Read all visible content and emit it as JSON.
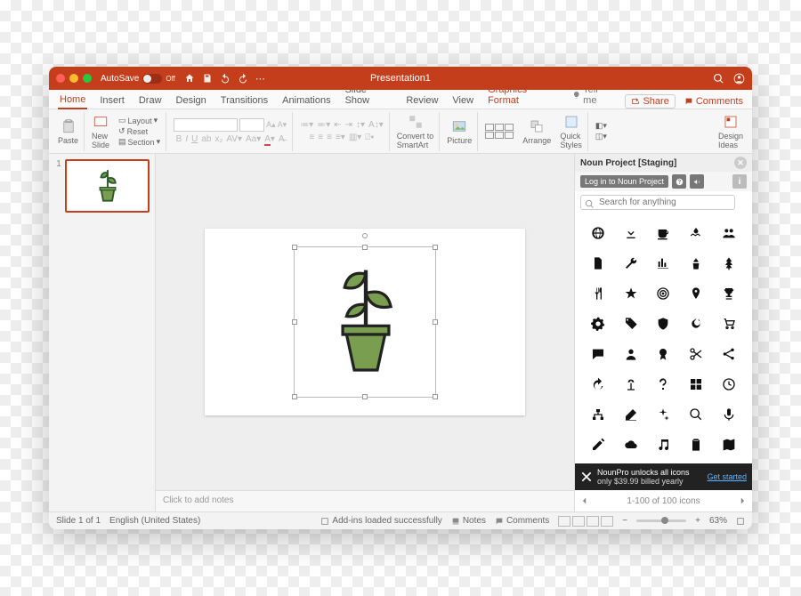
{
  "window": {
    "title": "Presentation1",
    "autosave_label": "AutoSave",
    "autosave_state": "Off"
  },
  "tabs": {
    "items": [
      "Home",
      "Insert",
      "Draw",
      "Design",
      "Transitions",
      "Animations",
      "Slide Show",
      "Review",
      "View"
    ],
    "context": "Graphics Format",
    "tellme": "Tell me",
    "share": "Share",
    "comments": "Comments",
    "active_index": 0
  },
  "ribbon": {
    "paste": "Paste",
    "new_slide": "New\nSlide",
    "layout": "Layout",
    "reset": "Reset",
    "section": "Section",
    "convert": "Convert to\nSmartArt",
    "picture": "Picture",
    "arrange": "Arrange",
    "quick_styles": "Quick\nStyles",
    "design_ideas": "Design\nIdeas"
  },
  "thumbnails": {
    "num1": "1"
  },
  "notes": {
    "placeholder": "Click to add notes"
  },
  "panel": {
    "title": "Noun Project [Staging]",
    "login": "Log in to Noun Project",
    "search_placeholder": "Search for anything",
    "upsell_title": "NounPro unlocks all icons",
    "upsell_sub": "only $39.99 billed yearly",
    "upsell_link": "Get started",
    "pager": "1-100 of 100 icons",
    "icons": [
      "globe-icon",
      "download-icon",
      "coffee-icon",
      "water-icon",
      "group-icon",
      "document-icon",
      "wrench-icon",
      "bars-icon",
      "plant-icon",
      "tree-icon",
      "cutlery-icon",
      "star-icon",
      "target-icon",
      "pin-icon",
      "trophy-icon",
      "gear-icon",
      "tag-icon",
      "shield-icon",
      "fire-icon",
      "cart-icon",
      "chat-icon",
      "user-icon",
      "medal-icon",
      "scissors-icon",
      "share-icon",
      "redo-icon",
      "sprout-icon",
      "question-icon",
      "grid-icon",
      "clock-icon",
      "hierarchy-icon",
      "eraser-icon",
      "spark-icon",
      "search-icon",
      "mic-icon",
      "pencil-icon",
      "cloud-icon",
      "music-icon",
      "clipboard-icon",
      "map-icon"
    ]
  },
  "status": {
    "slide": "Slide 1 of 1",
    "lang": "English (United States)",
    "addins": "Add-ins loaded successfully",
    "notes": "Notes",
    "comments": "Comments",
    "zoom": "63%"
  }
}
